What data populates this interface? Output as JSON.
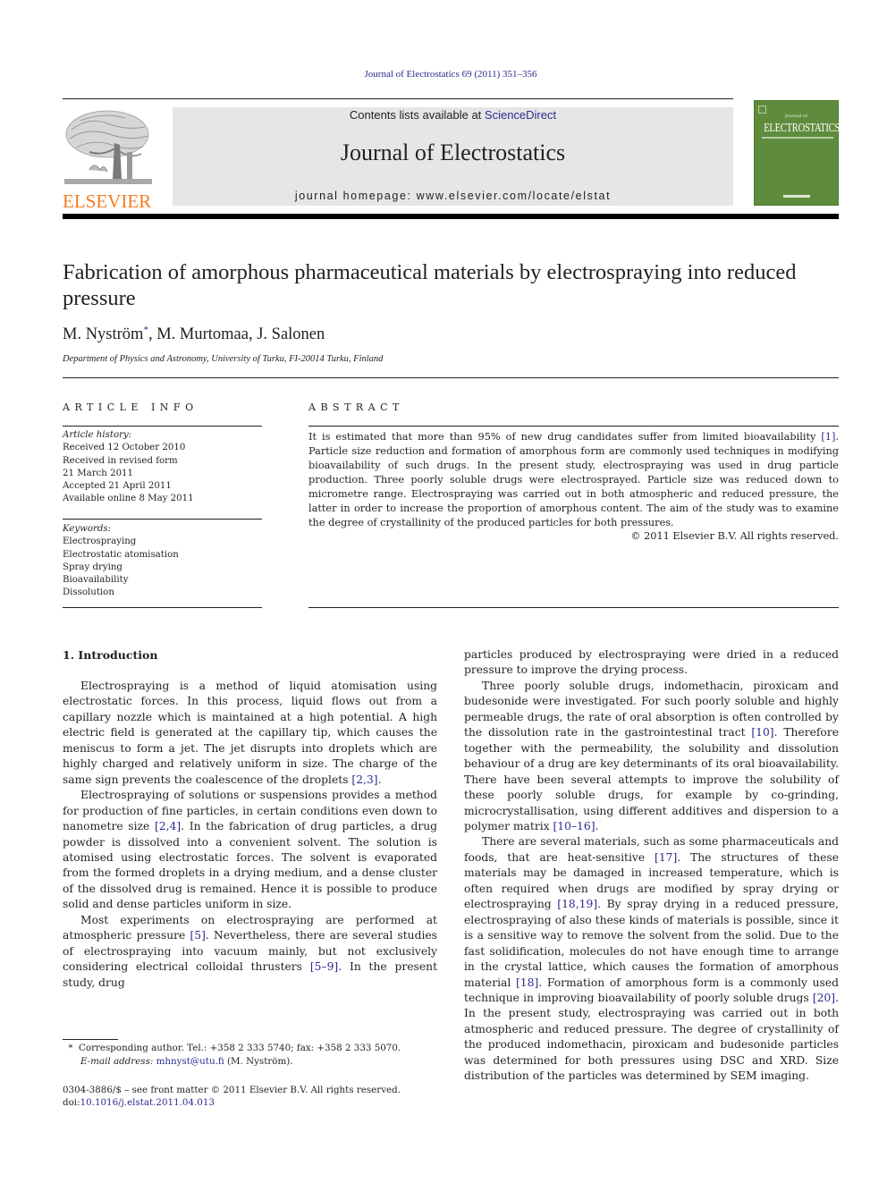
{
  "header": {
    "citation": "Journal of Electrostatics 69 (2011) 351–356",
    "publisher_logo_text": "ELSEVIER",
    "contents_prefix": "Contents lists available at ",
    "contents_link": "ScienceDirect",
    "journal_title": "Journal of Electrostatics",
    "homepage": "journal homepage: www.elsevier.com/locate/elstat",
    "cover": {
      "small_text": "Journal of",
      "title": "ELECTROSTATICS",
      "color": "#5f8c3c"
    },
    "logo_color": "#f47b20",
    "link_color": "#2b2b8f"
  },
  "article": {
    "title": "Fabrication of amorphous pharmaceutical materials by electrospraying into reduced pressure",
    "authors": [
      {
        "name": "M. Nyström",
        "mark": "*"
      },
      {
        "name": "M. Murtomaa",
        "mark": ""
      },
      {
        "name": "J. Salonen",
        "mark": ""
      }
    ],
    "affiliation": "Department of Physics and Astronomy, University of Turku, FI-20014 Turku, Finland"
  },
  "article_info": {
    "heading": "ARTICLE INFO",
    "history_label": "Article history:",
    "history": [
      "Received 12 October 2010",
      "Received in revised form",
      "21 March 2011",
      "Accepted 21 April 2011",
      "Available online 8 May 2011"
    ],
    "keywords_label": "Keywords:",
    "keywords": [
      "Electrospraying",
      "Electrostatic atomisation",
      "Spray drying",
      "Bioavailability",
      "Dissolution"
    ]
  },
  "abstract": {
    "heading": "ABSTRACT",
    "text_before_ref": "It is estimated that more than 95% of new drug candidates suffer from limited bioavailability ",
    "ref": "[1]",
    "text_after_ref": ". Particle size reduction and formation of amorphous form are commonly used techniques in modifying bioavailability of such drugs. In the present study, electrospraying was used in drug particle production. Three poorly soluble drugs were electrosprayed. Particle size was reduced down to micrometre range. Electrospraying was carried out in both atmospheric and reduced pressure, the latter in order to increase the proportion of amorphous content. The aim of the study was to examine the degree of crystallinity of the produced particles for both pressures.",
    "copyright": "© 2011 Elsevier B.V. All rights reserved."
  },
  "body": {
    "section_title": "1.  Introduction",
    "left_paragraphs": [
      [
        {
          "t": "Electrospraying is a method of liquid atomisation using electrostatic forces. In this process, liquid flows out from a capillary nozzle which is maintained at a high potential. A high electric field is generated at the capillary tip, which causes the meniscus to form a jet. The jet disrupts into droplets which are highly charged and relatively uniform in size. The charge of the same sign prevents the coalescence of the droplets "
        },
        {
          "ref": "[2,3]"
        },
        {
          "t": "."
        }
      ],
      [
        {
          "t": "Electrospraying of solutions or suspensions provides a method for production of fine particles, in certain conditions even down to nanometre size "
        },
        {
          "ref": "[2,4]"
        },
        {
          "t": ". In the fabrication of drug particles, a drug powder is dissolved into a convenient solvent. The solution is atomised using electrostatic forces. The solvent is evaporated from the formed droplets in a drying medium, and a dense cluster of the dissolved drug is remained. Hence it is possible to produce solid and dense particles uniform in size."
        }
      ],
      [
        {
          "t": "Most experiments on electrospraying are performed at atmospheric pressure "
        },
        {
          "ref": "[5]"
        },
        {
          "t": ". Nevertheless, there are several studies of electrospraying into vacuum mainly, but not exclusively considering electrical colloidal thrusters "
        },
        {
          "ref": "[5–9]"
        },
        {
          "t": ". In the present study, drug"
        }
      ]
    ],
    "right_paragraphs": [
      [
        {
          "t": "particles produced by electrospraying were dried in a reduced pressure to improve the drying process."
        }
      ],
      [
        {
          "t": "Three poorly soluble drugs, indomethacin, piroxicam and budesonide were investigated. For such poorly soluble and highly permeable drugs, the rate of oral absorption is often controlled by the dissolution rate in the gastrointestinal tract "
        },
        {
          "ref": "[10]"
        },
        {
          "t": ". Therefore together with the permeability, the solubility and dissolution behaviour of a drug are key determinants of its oral bioavailability. There have been several attempts to improve the solubility of these poorly soluble drugs, for example by co-grinding, microcrystallisation, using different additives and dispersion to a polymer matrix "
        },
        {
          "ref": "[10–16]"
        },
        {
          "t": "."
        }
      ],
      [
        {
          "t": "There are several materials, such as some pharmaceuticals and foods, that are heat-sensitive "
        },
        {
          "ref": "[17]"
        },
        {
          "t": ". The structures of these materials may be damaged in increased temperature, which is often required when drugs are modified by spray drying or electrospraying "
        },
        {
          "ref": "[18,19]"
        },
        {
          "t": ". By spray drying in a reduced pressure, electrospraying of also these kinds of materials is possible, since it is a sensitive way to remove the solvent from the solid. Due to the fast solidification, molecules do not have enough time to arrange in the crystal lattice, which causes the formation of amorphous material "
        },
        {
          "ref": "[18]"
        },
        {
          "t": ". Formation of amorphous form is a commonly used technique in improving bioavailability of poorly soluble drugs "
        },
        {
          "ref": "[20]"
        },
        {
          "t": ". In the present study, electrospraying was carried out in both atmospheric and reduced pressure. The degree of crystallinity of the produced indomethacin, piroxicam and budesonide particles was determined for both pressures using DSC and XRD. Size distribution of the particles was determined by SEM imaging."
        }
      ]
    ]
  },
  "footnotes": {
    "star": "*",
    "corresponding": "Corresponding author. Tel.: +358 2 333 5740; fax: +358 2 333 5070.",
    "email_label": "E-mail address: ",
    "email": "mhnyst@utu.fi",
    "email_suffix": " (M. Nyström).",
    "front_matter": "0304-3886/$ – see front matter © 2011 Elsevier B.V. All rights reserved.",
    "doi_label": "doi:",
    "doi": "10.1016/j.elstat.2011.04.013"
  }
}
